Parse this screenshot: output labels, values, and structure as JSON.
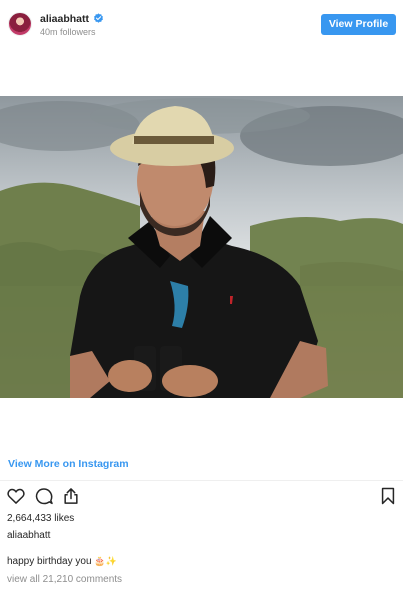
{
  "header": {
    "username": "aliaabhatt",
    "followers": "40m followers",
    "view_profile_label": "View Profile",
    "verified_color": "#3897f0"
  },
  "post": {
    "view_more_label": "View More on Instagram",
    "likes": "2,664,433 likes",
    "author": "aliaabhatt",
    "caption": "happy birthday you",
    "caption_emoji": "🎂✨",
    "comments_link": "view all 21,210 comments"
  },
  "icons": {
    "like": "heart-icon",
    "comment": "comment-icon",
    "share": "share-icon",
    "save": "bookmark-icon"
  },
  "colors": {
    "accent": "#3897f0",
    "muted": "#8e8e8e",
    "text": "#262626"
  }
}
